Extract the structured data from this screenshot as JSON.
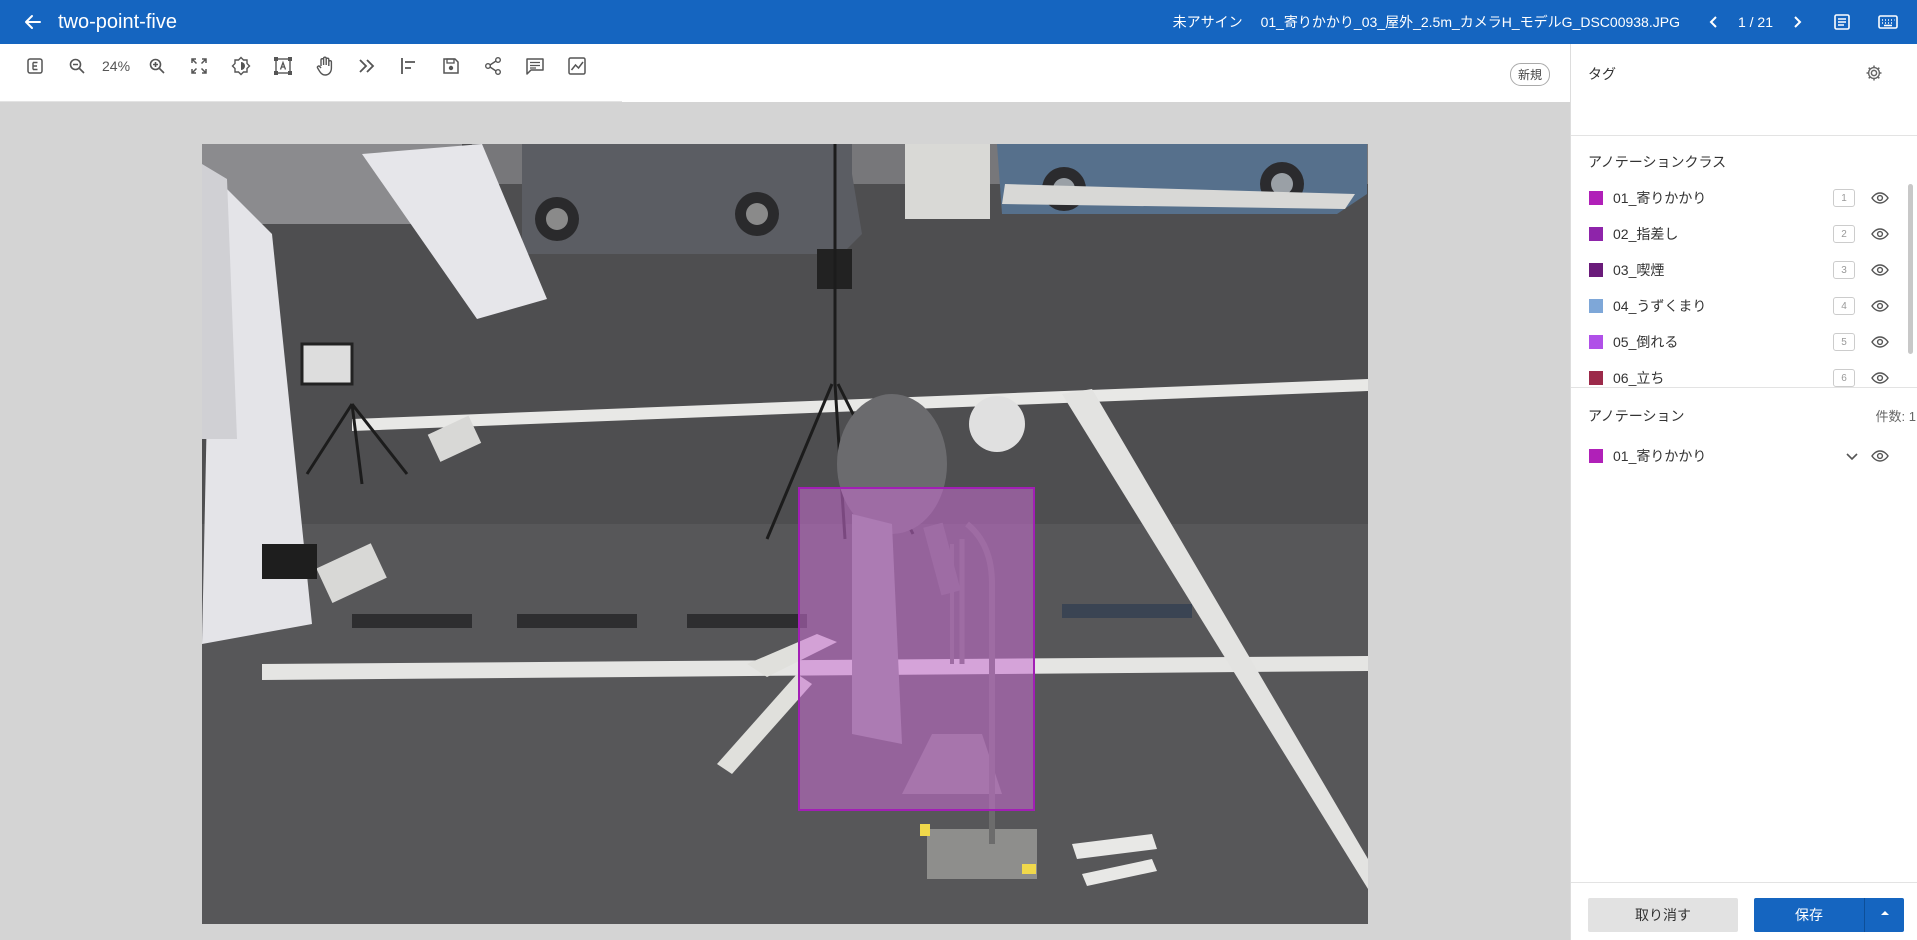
{
  "header": {
    "project_title": "two-point-five",
    "assign_status": "未アサイン",
    "file_name": "01_寄りかかり_03_屋外_2.5m_カメラH_モデルG_DSC00938.JPG",
    "pager": "1 / 21",
    "icons": [
      "back-arrow-icon",
      "chevron-left-icon",
      "chevron-right-icon",
      "notes-icon",
      "keyboard-icon"
    ]
  },
  "toolbar": {
    "zoom": "24%",
    "new_badge": "新規",
    "tools": [
      "e-icon",
      "zoom-out-icon",
      "zoom-in-icon",
      "fit-screen-icon",
      "brightness-icon",
      "bbox-tool-icon",
      "pan-hand-icon",
      "skip-icon",
      "align-icon",
      "save-icon",
      "share-icon",
      "comment-icon",
      "chart-icon"
    ]
  },
  "tags": {
    "title": "タグ"
  },
  "classes": {
    "title": "アノテーションクラス",
    "items": [
      {
        "label": "01_寄りかかり",
        "key": "1",
        "color": "#b020b8"
      },
      {
        "label": "02_指差し",
        "key": "2",
        "color": "#8e24aa"
      },
      {
        "label": "03_喫煙",
        "key": "3",
        "color": "#6a1b7a"
      },
      {
        "label": "04_うずくまり",
        "key": "4",
        "color": "#7ea7d8"
      },
      {
        "label": "05_倒れる",
        "key": "5",
        "color": "#b050e8"
      },
      {
        "label": "06_立ち",
        "key": "6",
        "color": "#9c2a4a"
      }
    ]
  },
  "annotations": {
    "title": "アノテーション",
    "count": "件数: 1",
    "items": [
      {
        "label": "01_寄りかかり",
        "color": "#b020b8"
      }
    ]
  },
  "footer": {
    "cancel": "取り消す",
    "save": "保存"
  }
}
